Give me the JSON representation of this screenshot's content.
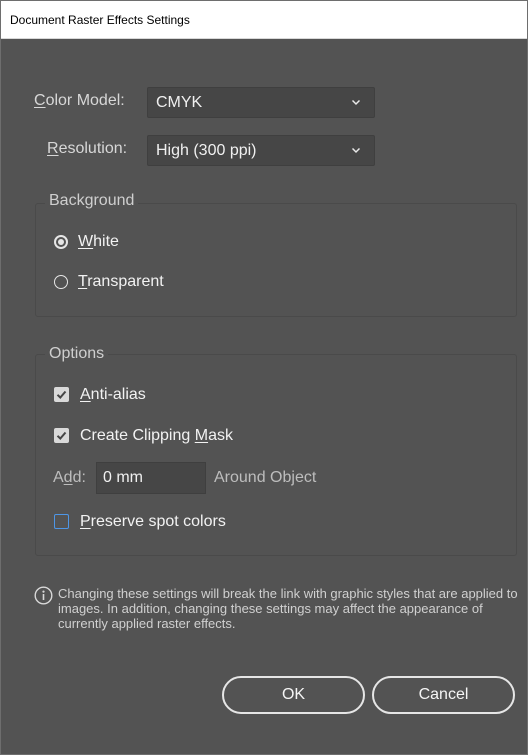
{
  "window": {
    "title": "Document Raster Effects Settings"
  },
  "color_model": {
    "label_ul": "C",
    "label_rest": "olor Model:",
    "value": "CMYK"
  },
  "resolution": {
    "label_ul": "R",
    "label_rest": "esolution:",
    "value": "High (300 ppi)"
  },
  "background": {
    "legend": "Background",
    "options": [
      {
        "ul": "W",
        "rest": "hite",
        "selected": true
      },
      {
        "ul": "T",
        "rest": "ransparent",
        "selected": false
      }
    ]
  },
  "options": {
    "legend": "Options",
    "anti_alias": {
      "ul": "A",
      "rest": "nti-alias",
      "checked": true
    },
    "clipping_mask": {
      "pre": "Create Clipping ",
      "ul": "M",
      "rest": "ask",
      "checked": true
    },
    "add": {
      "pre": "A",
      "ul": "d",
      "rest": "d:",
      "value": "0 mm",
      "suffix": "Around Object"
    },
    "preserve_spot": {
      "ul": "P",
      "rest": "reserve spot colors",
      "checked": false
    }
  },
  "info_text": "Changing these settings will break the link with graphic styles that are applied to images. In addition, changing these settings may affect the appearance of currently applied raster effects.",
  "buttons": {
    "ok": "OK",
    "cancel": "Cancel"
  },
  "icons": [
    "chevron-down-icon",
    "checkmark-icon",
    "info-icon"
  ],
  "colors": {
    "dialog_bg": "#535353",
    "field_bg": "#464646",
    "focus_blue": "#4e96e6"
  }
}
